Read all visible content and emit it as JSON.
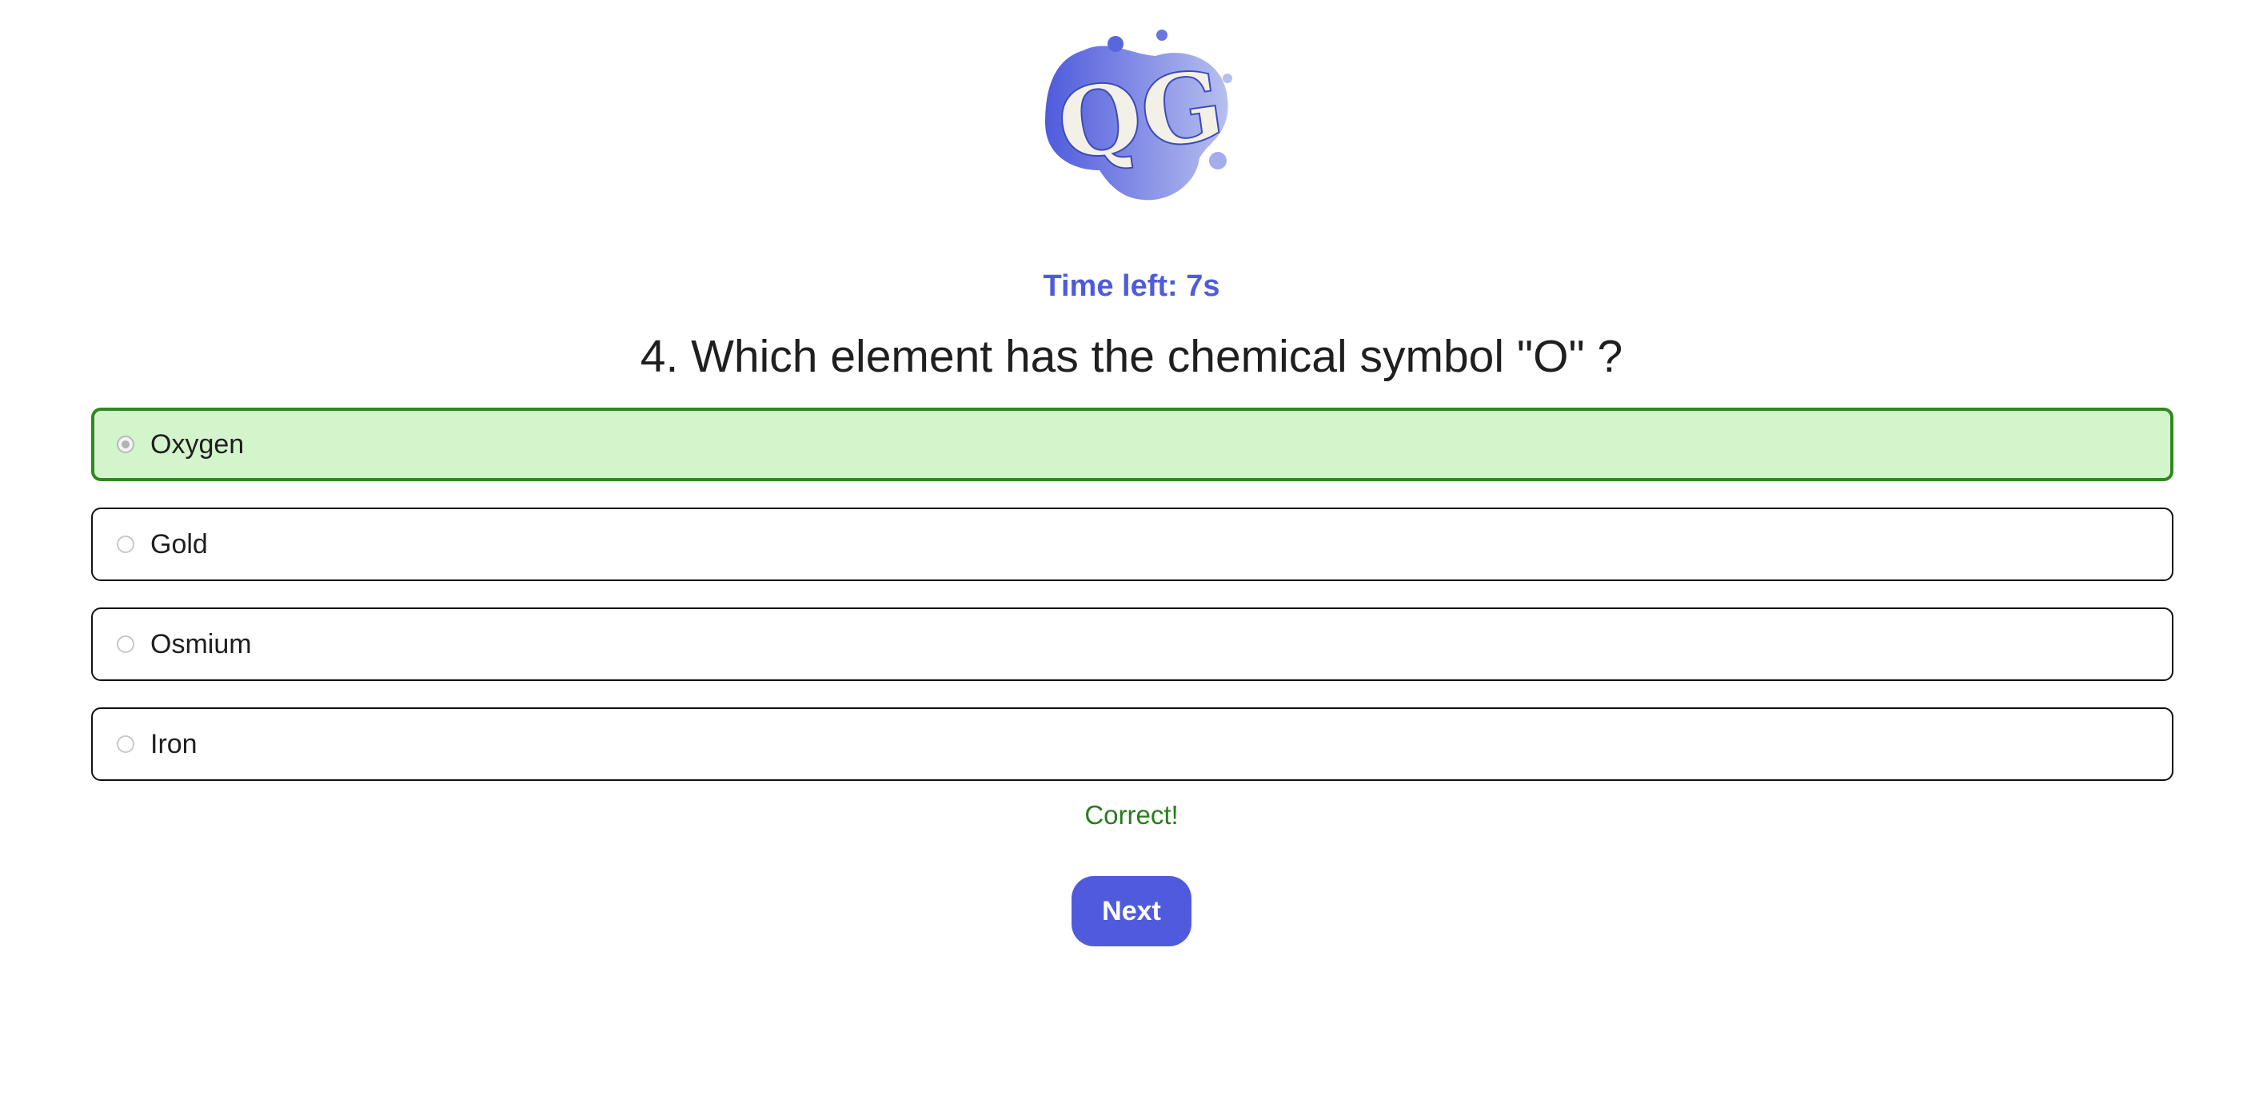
{
  "logo": {
    "icon": "qg-blob-logo-icon",
    "monogram": "QG",
    "gradient_start": "#4f5bdc",
    "gradient_end": "#b7bfef",
    "letter_color": "#f3f1e7"
  },
  "timer": {
    "text": "Time left: 7s",
    "color": "#4f5bdc"
  },
  "question": {
    "text": "4. Which element has the chemical symbol \"O\" ?"
  },
  "options": [
    {
      "label": "Oxygen",
      "state": "correct",
      "selected": true
    },
    {
      "label": "Gold",
      "state": "default",
      "selected": false
    },
    {
      "label": "Osmium",
      "state": "default",
      "selected": false
    },
    {
      "label": "Iron",
      "state": "default",
      "selected": false
    }
  ],
  "feedback": {
    "text": "Correct!",
    "color": "#2a7d1d"
  },
  "next_button": {
    "label": "Next",
    "color": "#4f5bdc"
  },
  "colors": {
    "correct_bg": "#d3f5cc",
    "correct_border": "#2f8a1e",
    "option_border": "#111111"
  }
}
